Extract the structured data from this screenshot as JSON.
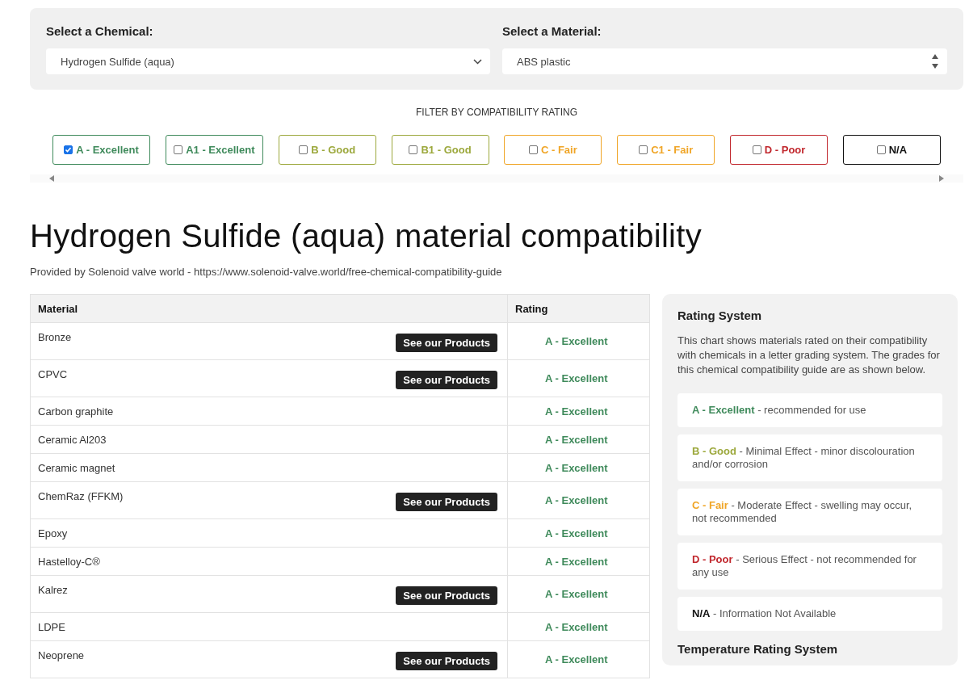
{
  "selectors": [
    {
      "label": "Select a Chemical:",
      "kind": "dropdown",
      "value": "Hydrogen Sulfide (aqua)"
    },
    {
      "label": "Select a Material:",
      "kind": "listbox",
      "value": "ABS plastic"
    }
  ],
  "filter": {
    "title": "FILTER BY COMPATIBILITY RATING",
    "options": [
      {
        "label": "A - Excellent",
        "color": "#3f8a5b",
        "checked": true
      },
      {
        "label": "A1 - Excellent",
        "color": "#3f8a5b",
        "checked": false
      },
      {
        "label": "B - Good",
        "color": "#9ca83c",
        "checked": false
      },
      {
        "label": "B1 - Good",
        "color": "#9ca83c",
        "checked": false
      },
      {
        "label": "C - Fair",
        "color": "#f0a526",
        "checked": false
      },
      {
        "label": "C1 - Fair",
        "color": "#f0a526",
        "checked": false
      },
      {
        "label": "D - Poor",
        "color": "#c1272d",
        "checked": false
      },
      {
        "label": "N/A",
        "color": "#111111",
        "checked": false
      }
    ]
  },
  "title": "Hydrogen Sulfide (aqua) material compatibility",
  "source": "Provided by Solenoid valve world - https://www.solenoid-valve.world/free-chemical-compatibility-guide",
  "table": {
    "columns": [
      "Material",
      "Rating"
    ],
    "rows": [
      {
        "material": "Bronze",
        "button": "See our Products",
        "rating": "A - Excellent",
        "color": "#3f8a5b"
      },
      {
        "material": "CPVC",
        "button": "See our Products",
        "rating": "A - Excellent",
        "color": "#3f8a5b"
      },
      {
        "material": "Carbon graphite",
        "rating": "A - Excellent",
        "color": "#3f8a5b"
      },
      {
        "material": "Ceramic Al203",
        "rating": "A - Excellent",
        "color": "#3f8a5b"
      },
      {
        "material": "Ceramic magnet",
        "rating": "A - Excellent",
        "color": "#3f8a5b"
      },
      {
        "material": "ChemRaz (FFKM)",
        "button": "See our Products",
        "rating": "A - Excellent",
        "color": "#3f8a5b"
      },
      {
        "material": "Epoxy",
        "rating": "A - Excellent",
        "color": "#3f8a5b"
      },
      {
        "material": "Hastelloy-C®",
        "rating": "A - Excellent",
        "color": "#3f8a5b"
      },
      {
        "material": "Kalrez",
        "button": "See our Products",
        "rating": "A - Excellent",
        "color": "#3f8a5b"
      },
      {
        "material": "LDPE",
        "rating": "A - Excellent",
        "color": "#3f8a5b"
      },
      {
        "material": "Neoprene",
        "button": "See our Products",
        "rating": "A - Excellent",
        "color": "#3f8a5b"
      }
    ]
  },
  "sidebar": {
    "title": "Rating System",
    "intro": "This chart shows materials rated on their compatibility with chemicals in a letter grading system. The grades for this chemical compatibility guide are as shown below.",
    "grades": [
      {
        "grade": "A - Excellent",
        "color": "#3f8a5b",
        "description": "- recommended for use"
      },
      {
        "grade": "B - Good",
        "color": "#9ca83c",
        "description": "- Minimal Effect - minor discolouration and/or corrosion"
      },
      {
        "grade": "C - Fair",
        "color": "#f0a526",
        "description": "- Moderate Effect - swelling may occur, not recommended"
      },
      {
        "grade": "D - Poor",
        "color": "#c1272d",
        "description": "- Serious Effect - not recommended for any use"
      },
      {
        "grade": "N/A",
        "color": "#111111",
        "description": "- Information Not Available"
      }
    ],
    "next_title": "Temperature Rating System"
  }
}
